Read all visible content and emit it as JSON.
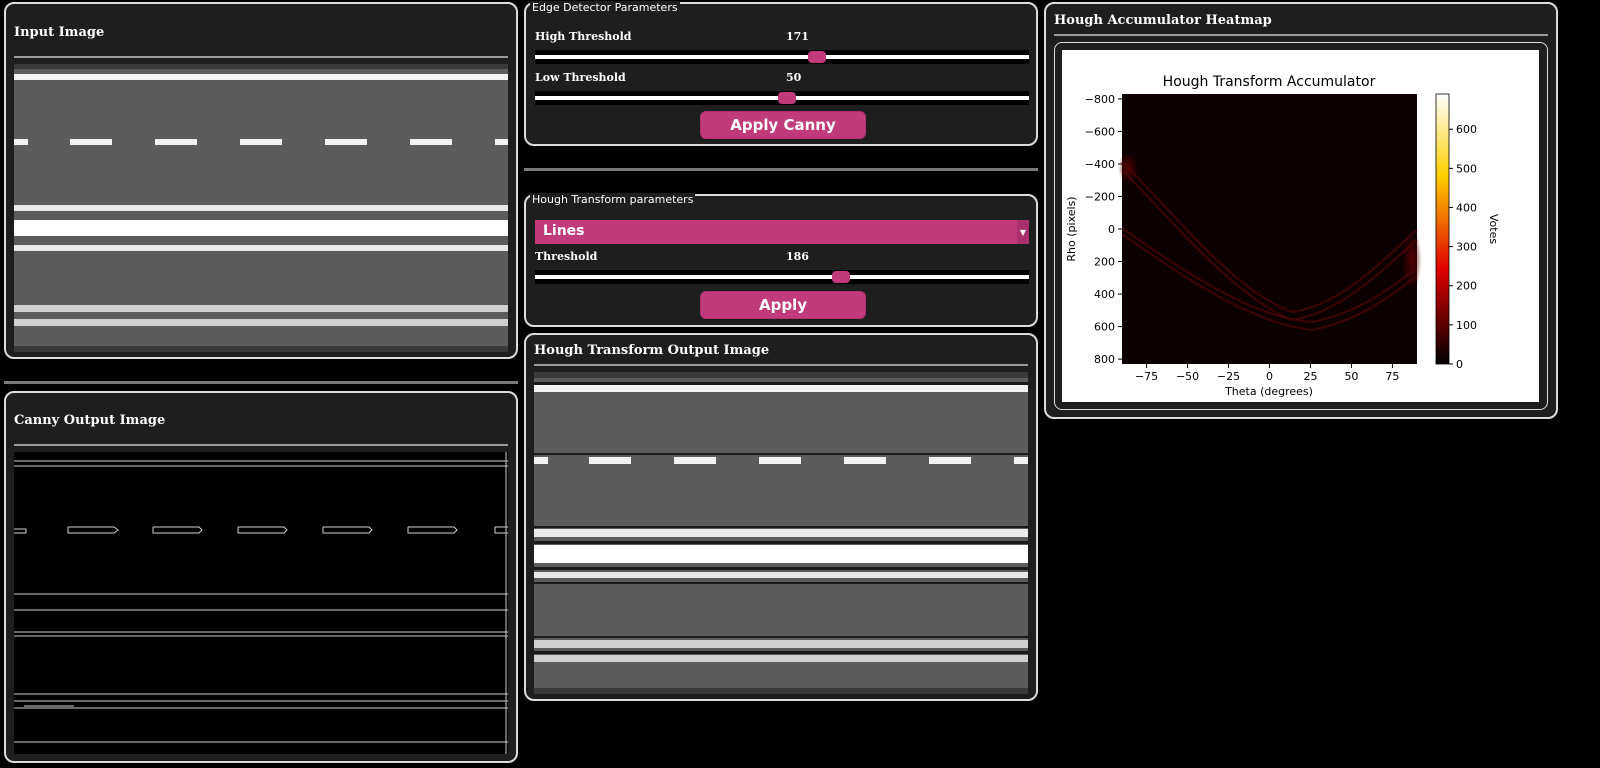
{
  "input_panel": {
    "title": "Input Image"
  },
  "canny_panel": {
    "title": "Canny Output Image"
  },
  "edge_params": {
    "legend": "Edge Detector Parameters",
    "high_label": "High Threshold",
    "high_value": "171",
    "high_fraction": 0.57,
    "low_label": "Low Threshold",
    "low_value": "50",
    "low_fraction": 0.51,
    "apply_label": "Apply Canny"
  },
  "hough_params": {
    "legend": "Hough Transform parameters",
    "mode_selected": "Lines",
    "threshold_label": "Threshold",
    "threshold_value": "186",
    "threshold_fraction": 0.62,
    "apply_label": "Apply"
  },
  "hough_output_panel": {
    "title": "Hough Transform Output Image"
  },
  "heatmap_panel": {
    "title": "Hough Accumulator Heatmap"
  },
  "icons": {
    "dropdown": "chevron-down-icon"
  },
  "colors": {
    "accent": "#c13b7b",
    "panel_bg": "#1e1e1e",
    "road": "#5a5a5a"
  },
  "chart_data": {
    "type": "heatmap",
    "title": "Hough Transform Accumulator",
    "xlabel": "Theta (degrees)",
    "ylabel": "Rho (pixels)",
    "colorbar_label": "Votes",
    "xticks": [
      "−75",
      "−50",
      "−25",
      "0",
      "25",
      "50",
      "75"
    ],
    "xtick_values": [
      -75,
      -50,
      -25,
      0,
      25,
      50,
      75
    ],
    "yticks": [
      "−800",
      "−600",
      "−400",
      "−200",
      "0",
      "200",
      "400",
      "600",
      "800"
    ],
    "ytick_values": [
      -800,
      -600,
      -400,
      -200,
      0,
      200,
      400,
      600,
      800
    ],
    "cbar_ticks": [
      "0",
      "100",
      "200",
      "300",
      "400",
      "500",
      "600"
    ],
    "cbar_tick_values": [
      0,
      100,
      200,
      300,
      400,
      500,
      600
    ],
    "xlim": [
      -90,
      90
    ],
    "ylim": [
      -830,
      830
    ],
    "cbar_range": [
      0,
      690
    ],
    "colormap": "hot"
  }
}
